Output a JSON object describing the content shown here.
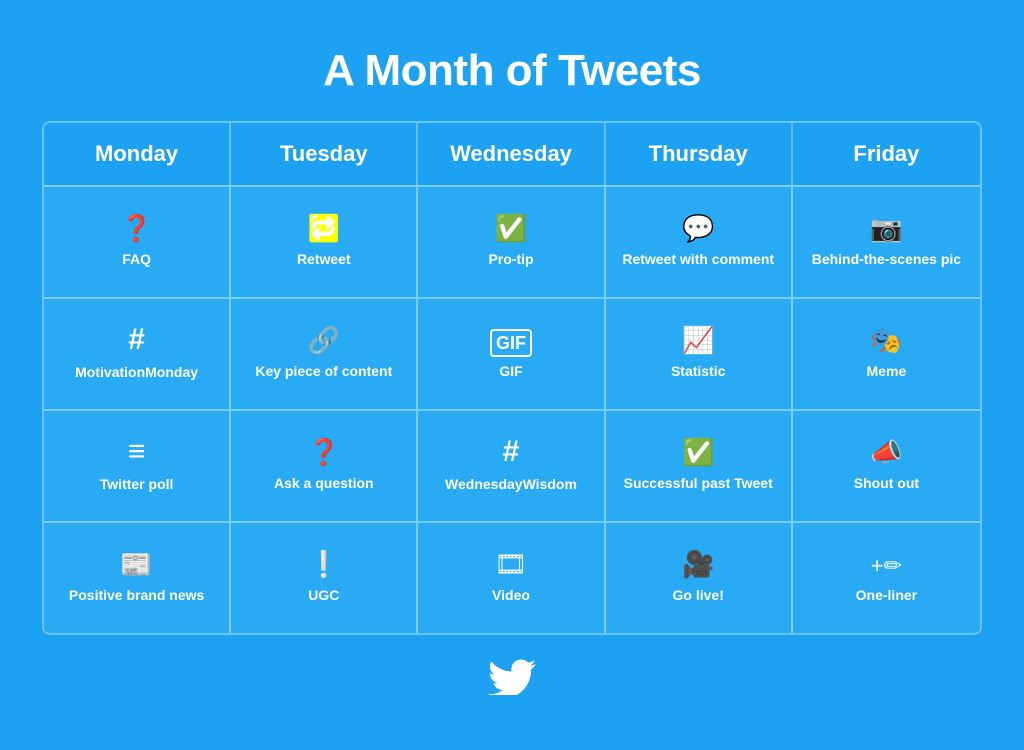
{
  "page": {
    "title": "A Month of Tweets",
    "bg_color": "#1DA1F2"
  },
  "columns": [
    "Monday",
    "Tuesday",
    "Wednesday",
    "Thursday",
    "Friday"
  ],
  "rows": [
    [
      {
        "label": "FAQ",
        "icon": "faq"
      },
      {
        "label": "Retweet",
        "icon": "retweet"
      },
      {
        "label": "Pro-tip",
        "icon": "protip"
      },
      {
        "label": "Retweet with comment",
        "icon": "retweet-comment"
      },
      {
        "label": "Behind-the-scenes pic",
        "icon": "camera"
      }
    ],
    [
      {
        "label": "MotivationMonday",
        "icon": "hashtag"
      },
      {
        "label": "Key piece of content",
        "icon": "link"
      },
      {
        "label": "GIF",
        "icon": "gif"
      },
      {
        "label": "Statistic",
        "icon": "statistic"
      },
      {
        "label": "Meme",
        "icon": "meme"
      }
    ],
    [
      {
        "label": "Twitter poll",
        "icon": "poll"
      },
      {
        "label": "Ask a question",
        "icon": "question"
      },
      {
        "label": "WednesdayWisdom",
        "icon": "wisdom"
      },
      {
        "label": "Successful past Tweet",
        "icon": "success"
      },
      {
        "label": "Shout out",
        "icon": "shout"
      }
    ],
    [
      {
        "label": "Positive brand news",
        "icon": "news"
      },
      {
        "label": "UGC",
        "icon": "ugc"
      },
      {
        "label": "Video",
        "icon": "video"
      },
      {
        "label": "Go live!",
        "icon": "live"
      },
      {
        "label": "One-liner",
        "icon": "oneliner"
      }
    ]
  ]
}
